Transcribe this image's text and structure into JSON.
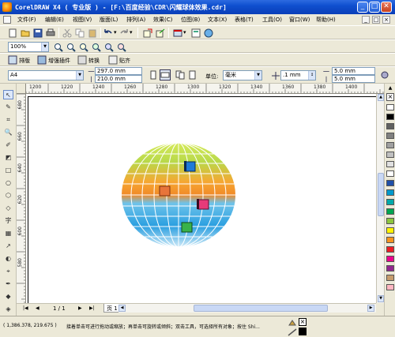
{
  "window": {
    "title": "CorelDRAW X4 ( 专业版 ) - [F:\\百度经验\\CDR\\闪耀球体效果.cdr]",
    "minimize": "_",
    "maximize": "□",
    "close": "✕"
  },
  "menu": [
    "文件(F)",
    "编辑(E)",
    "视图(V)",
    "版面(L)",
    "排列(A)",
    "效果(C)",
    "位图(B)",
    "文本(X)",
    "表格(T)",
    "工具(O)",
    "窗口(W)",
    "帮助(H)"
  ],
  "standard_toolbar": {
    "zoom_value": "100%"
  },
  "transform_toolbar": {
    "trim": "排版",
    "enhance": "增强插件",
    "convert": "转换",
    "stick": "贴齐"
  },
  "property_bar": {
    "page_size": "A4",
    "width": "297.0 mm",
    "height": "210.0 mm",
    "units_label": "单位:",
    "units_value": "毫米",
    "nudge": ".1 mm",
    "dup_x": "5.0 mm",
    "dup_y": "5.0 mm"
  },
  "ruler": {
    "h_labels": [
      "1200",
      "1220",
      "1240",
      "1260",
      "1280",
      "1300",
      "1320",
      "1340",
      "1360",
      "1380",
      "1400"
    ],
    "v_labels": [
      "680",
      "660",
      "640",
      "620",
      "600",
      "580"
    ]
  },
  "page_nav": {
    "first": "|◀",
    "prev": "◀",
    "counter": "1 / 1",
    "next": "▶",
    "last": "▶|",
    "tab": "页 1"
  },
  "status": {
    "coords": "( 1,386.378, 219.675 )",
    "hint": "接着单击可进行拖动或缩放；再单击可旋转或倾斜；双击工具，可选择所有对象；按住 Shi..."
  },
  "palette_colors": [
    "#ffffff",
    "#000000",
    "#606060",
    "#808080",
    "#a0a0a0",
    "#c0c0c0",
    "#e0e0e0",
    "#ffffff",
    "#1f4fa8",
    "#0099cc",
    "#00aaaa",
    "#00a651",
    "#8dc63f",
    "#fff200",
    "#f7941d",
    "#ed1c24",
    "#ec008c",
    "#92278f",
    "#c69c6d",
    "#ffb6c1"
  ],
  "sphere_squares": {
    "blue": "#1f7ad8",
    "orange": "#e8743a",
    "pink": "#e63a79",
    "green": "#38b24a"
  }
}
